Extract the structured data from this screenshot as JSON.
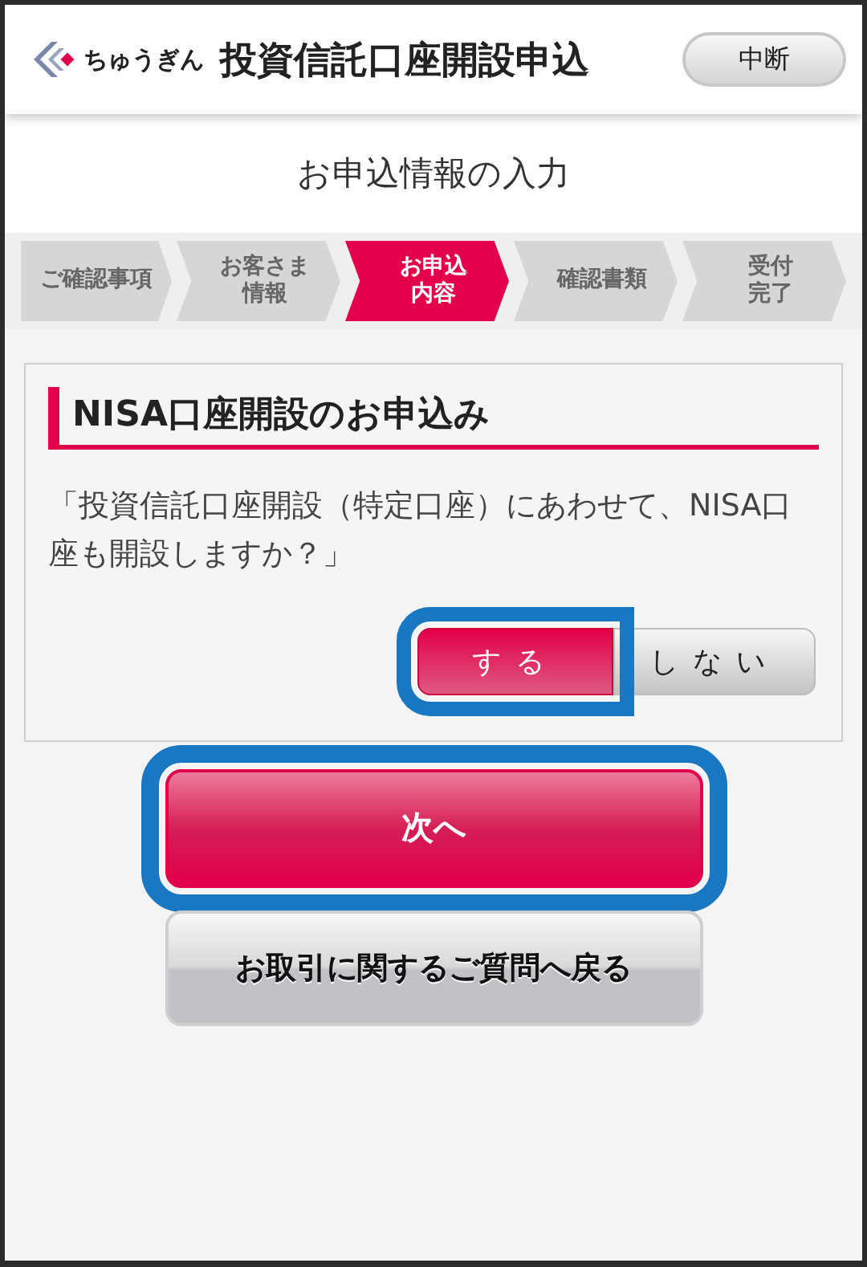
{
  "header": {
    "logo_text": "ちゅうぎん",
    "title": "投資信託口座開設申込",
    "cancel_button": "中断"
  },
  "page_title": "お申込情報の入力",
  "steps": [
    {
      "lines": [
        "ご確認事項"
      ],
      "selected": false
    },
    {
      "lines": [
        "お客さま",
        "情報"
      ],
      "selected": false
    },
    {
      "lines": [
        "お申込",
        "内容"
      ],
      "selected": true
    },
    {
      "lines": [
        "確認書類"
      ],
      "selected": false
    },
    {
      "lines": [
        "受付",
        "完了"
      ],
      "selected": false
    }
  ],
  "section": {
    "heading": "NISA口座開設のお申込み",
    "question": "「投資信託口座開設（特定口座）にあわせて、NISA口座も開設しますか？」",
    "options": [
      {
        "label": "する",
        "selected": true,
        "highlighted": true
      },
      {
        "label": "しない",
        "selected": false,
        "highlighted": false
      }
    ]
  },
  "next_button": {
    "label": "次へ",
    "highlighted": true
  },
  "back_button": {
    "label": "お取引に関するご質問へ戻る"
  }
}
